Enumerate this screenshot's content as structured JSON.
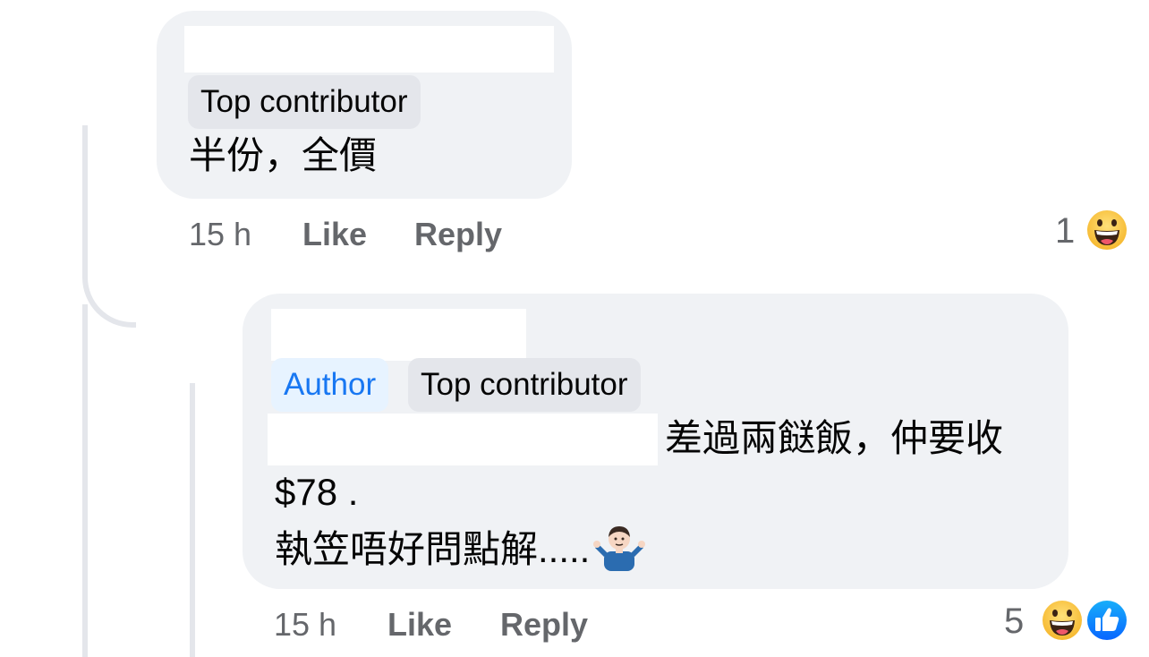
{
  "comments": [
    {
      "badges": [
        "Top contributor"
      ],
      "text": "半份，全價",
      "time": "15 h",
      "like_label": "Like",
      "reply_label": "Reply",
      "reaction_count": "1",
      "reactions": [
        "haha-icon"
      ]
    },
    {
      "badges": [
        "Author",
        "Top contributor"
      ],
      "text_line1": "差過兩餸飯，仲要收",
      "text_line2": "$78 .",
      "text_line3": "執笠唔好問點解.....",
      "time": "15 h",
      "like_label": "Like",
      "reply_label": "Reply",
      "reaction_count": "5",
      "reactions": [
        "haha-icon",
        "like-icon"
      ]
    }
  ],
  "colors": {
    "bubble": "#f0f2f5",
    "badge": "#e4e6eb",
    "author_badge_bg": "#e7f3ff",
    "author_badge_text": "#1877f2",
    "meta_text": "#65676b"
  }
}
